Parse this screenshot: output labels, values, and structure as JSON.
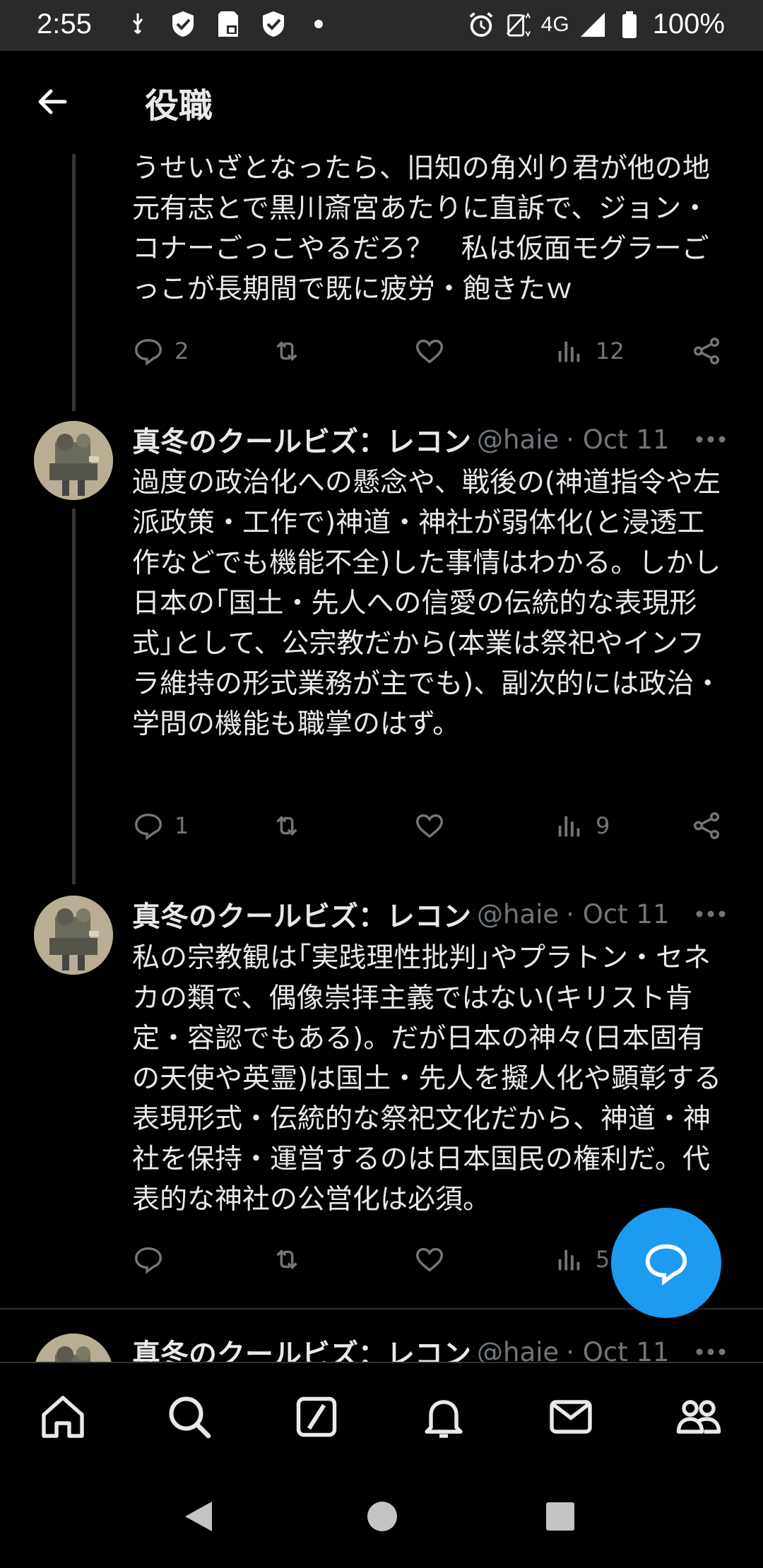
{
  "status_bar": {
    "time": "2:55",
    "network": "4G",
    "battery": "100%"
  },
  "header": {
    "title": "役職",
    "back_icon": "back-arrow-icon"
  },
  "tweets": [
    {
      "text": "うせいざとなったら、旧知の角刈り君が他の地元有志とで黒川斎宮あたりに直訴で、ジョン・コナーごっこやるだろ？　私は仮面モグラーごっこが長期間で既に疲労・飽きたｗ",
      "replies": "2",
      "views": "12"
    },
    {
      "name": "真冬のクールビズ：レコンキスタ",
      "handle": "@haie",
      "date": "· Oct 11",
      "text": "過度の政治化への懸念や、戦後の(神道指令や左派政策・工作で)神道・神社が弱体化(と浸透工作などでも機能不全)した事情はわかる。しかし日本の｢国土・先人への信愛の伝統的な表現形式｣として、公宗教だから(本業は祭祀やインフラ維持の形式業務が主でも)、副次的には政治・学問の機能も職掌のはず。",
      "replies": "1",
      "views": "9"
    },
    {
      "name": "真冬のクールビズ：レコンキスタ",
      "handle": "@haie",
      "date": "· Oct 11",
      "text": "私の宗教観は｢実践理性批判｣やプラトン・セネカの類で、偶像崇拝主義ではない(キリスト肯定・容認でもある)。だが日本の神々(日本固有の天使や英霊)は国土・先人を擬人化や顕彰する表現形式・伝統的な祭祀文化だから、神道・神社を保持・運営するのは日本国民の権利だ。代表的な神社の公営化は必須。",
      "replies": "",
      "views": "5"
    },
    {
      "name": "真冬のクールビズ：レコンキスタ",
      "handle": "@haie",
      "date": "· Oct 11"
    }
  ],
  "colors": {
    "background": "#000000",
    "accent": "#1d9bf0",
    "muted": "#71767b",
    "text": "#e7e9ea"
  },
  "bottom_nav": [
    "home-icon",
    "search-icon",
    "grok-icon",
    "notifications-icon",
    "messages-icon",
    "communities-icon"
  ],
  "fab": {
    "icon": "chat-bubble-icon"
  }
}
